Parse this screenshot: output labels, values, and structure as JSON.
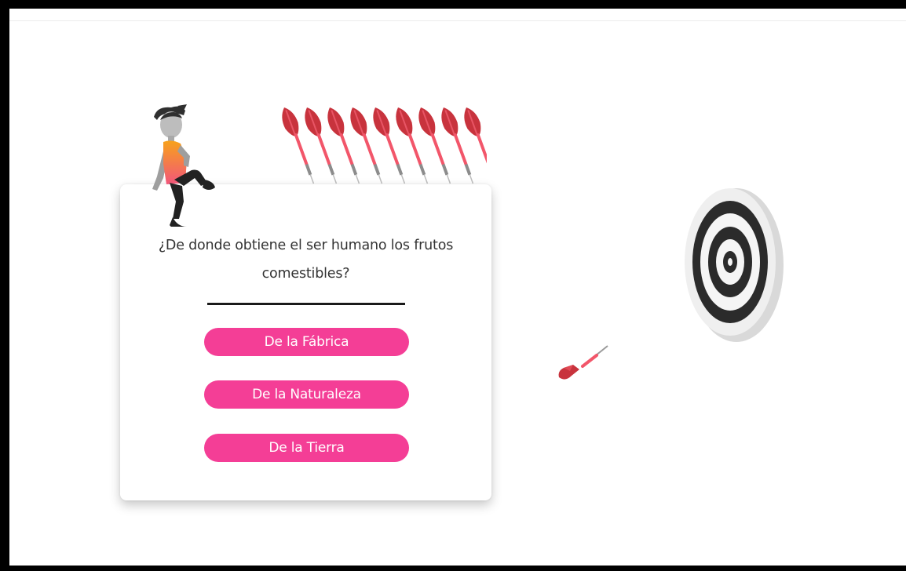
{
  "quiz": {
    "question": "¿De donde obtiene el ser humano los frutos\ncomestibles?",
    "answers": [
      {
        "label": "De la Fábrica"
      },
      {
        "label": "De la Naturaleza"
      },
      {
        "label": "De la Tierra"
      }
    ]
  },
  "illustration": {
    "remaining_darts": 9,
    "icons": [
      "character-icon",
      "dart-icon",
      "dartboard-icon"
    ]
  },
  "colors": {
    "answer_button": "#f43e96",
    "dart_red": "#c8333d",
    "dart_shaft": "#f2566a",
    "target_dark": "#2b2b2b",
    "target_light": "#e6e6e6",
    "shirt_orange": "#f7941d"
  }
}
